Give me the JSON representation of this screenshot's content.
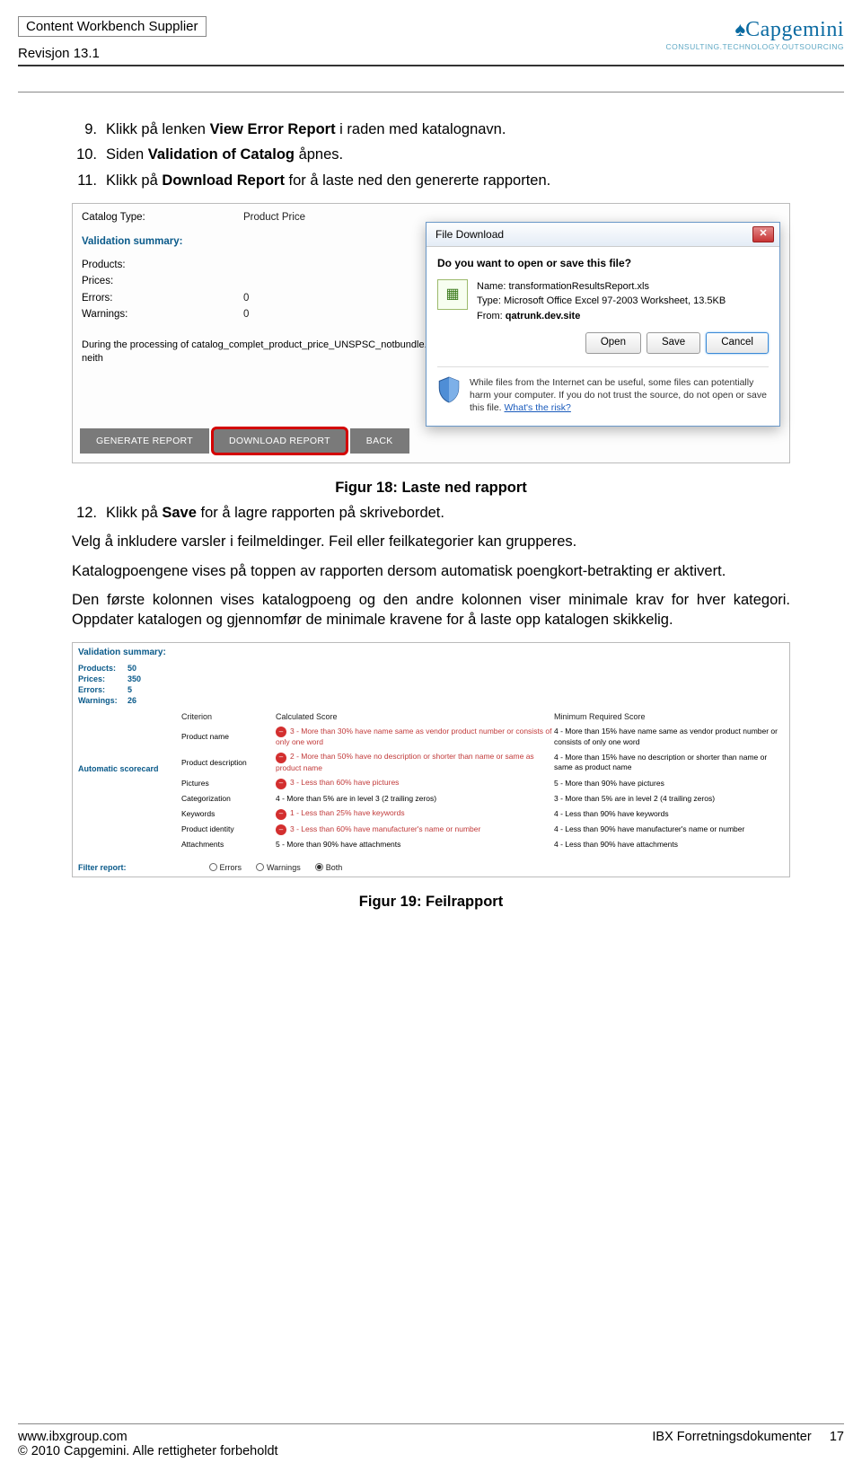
{
  "header": {
    "title": "Content Workbench Supplier",
    "revision": "Revisjon 13.1",
    "logo_name": "Capgemini",
    "logo_tag": "CONSULTING.TECHNOLOGY.OUTSOURCING"
  },
  "steps_a": [
    {
      "num": "9.",
      "text_pre": "Klikk på lenken ",
      "bold": "View Error Report",
      "text_post": " i raden med katalognavn."
    },
    {
      "num": "10.",
      "text_pre": "Siden ",
      "bold": "Validation of Catalog",
      "text_post": " åpnes."
    },
    {
      "num": "11.",
      "text_pre": "Klikk på ",
      "bold": "Download Report",
      "text_post": " for å laste ned den genererte rapporten."
    }
  ],
  "shot1": {
    "catalog_type_lab": "Catalog Type:",
    "catalog_type_val": "Product Price",
    "val_sum": "Validation summary:",
    "products_lab": "Products:",
    "prices_lab": "Prices:",
    "errors_lab": "Errors:",
    "errors_val": "0",
    "warnings_lab": "Warnings:",
    "warnings_val": "0",
    "processing": "During the processing of catalog_complet_product_price_UNSPSC_notbundle.xls neith",
    "btn_gen": "GENERATE REPORT",
    "btn_down": "DOWNLOAD REPORT",
    "btn_back": "BACK",
    "dlg_title": "File Download",
    "dlg_q": "Do you want to open or save this file?",
    "file_name_lab": "Name:",
    "file_name_val": "transformationResultsReport.xls",
    "file_type_lab": "Type:",
    "file_type_val": "Microsoft Office Excel 97-2003 Worksheet, 13.5KB",
    "file_from_lab": "From:",
    "file_from_val": "qatrunk.dev.site",
    "btn_open": "Open",
    "btn_save": "Save",
    "btn_cancel": "Cancel",
    "warn_txt": "While files from the Internet can be useful, some files can potentially harm your computer. If you do not trust the source, do not open or save this file. ",
    "warn_link": "What's the risk?"
  },
  "caption1": "Figur 18: Laste ned rapport",
  "steps_b": [
    {
      "num": "12.",
      "text_pre": "Klikk på ",
      "bold": "Save",
      "text_post": " for å lagre rapporten på skrivebordet."
    }
  ],
  "para1": "Velg å inkludere varsler i feilmeldinger. Feil eller feilkategorier kan grupperes.",
  "para2": "Katalogpoengene vises på toppen av rapporten dersom automatisk poengkort-betrakting er aktivert.",
  "para3": "Den første kolonnen vises katalogpoeng og den andre kolonnen viser minimale krav for hver kategori. Oppdater katalogen og gjennomfør de minimale kravene for å laste opp katalogen skikkelig.",
  "shot2": {
    "val_sum": "Validation summary:",
    "summary": [
      {
        "lab": "Products:",
        "val": "50"
      },
      {
        "lab": "Prices:",
        "val": "350"
      },
      {
        "lab": "Errors:",
        "val": "5"
      },
      {
        "lab": "Warnings:",
        "val": "26"
      }
    ],
    "auto_score": "Automatic scorecard",
    "col_crit": "Criterion",
    "col_calc": "Calculated Score",
    "col_min": "Minimum Required Score",
    "rows": [
      {
        "crit": "Product name",
        "bad": true,
        "calc": "3 - More than 30% have name same as vendor product number or consists of only one word",
        "min": "4 - More than 15% have name same as vendor product number or consists of only one word"
      },
      {
        "crit": "Product description",
        "bad": true,
        "calc": "2 - More than 50% have no description or shorter than name or same as product name",
        "min": "4 - More than 15% have no description or shorter than name or same as product name"
      },
      {
        "crit": "Pictures",
        "bad": true,
        "calc": "3 - Less than 60% have pictures",
        "min": "5 - More than 90% have pictures"
      },
      {
        "crit": "Categorization",
        "bad": false,
        "calc": "4 - More than 5% are in level 3 (2 trailing zeros)",
        "min": "3 - More than 5% are in level 2 (4 trailing zeros)"
      },
      {
        "crit": "Keywords",
        "bad": true,
        "calc": "1 - Less than 25% have keywords",
        "min": "4 - Less than 90% have keywords"
      },
      {
        "crit": "Product identity",
        "bad": true,
        "calc": "3 - Less than 60% have manufacturer's name or number",
        "min": "4 - Less than 90% have manufacturer's name or number"
      },
      {
        "crit": "Attachments",
        "bad": false,
        "calc": "5 - More than 90% have attachments",
        "min": "4 - Less than 90% have attachments"
      }
    ],
    "filter_lab": "Filter report:",
    "filter_err": "Errors",
    "filter_warn": "Warnings",
    "filter_both": "Both"
  },
  "caption2": "Figur 19: Feilrapport",
  "footer": {
    "url": "www.ibxgroup.com",
    "copy": "© 2010 Capgemini. Alle rettigheter forbeholdt",
    "doc": "IBX Forretningsdokumenter",
    "page": "17"
  }
}
